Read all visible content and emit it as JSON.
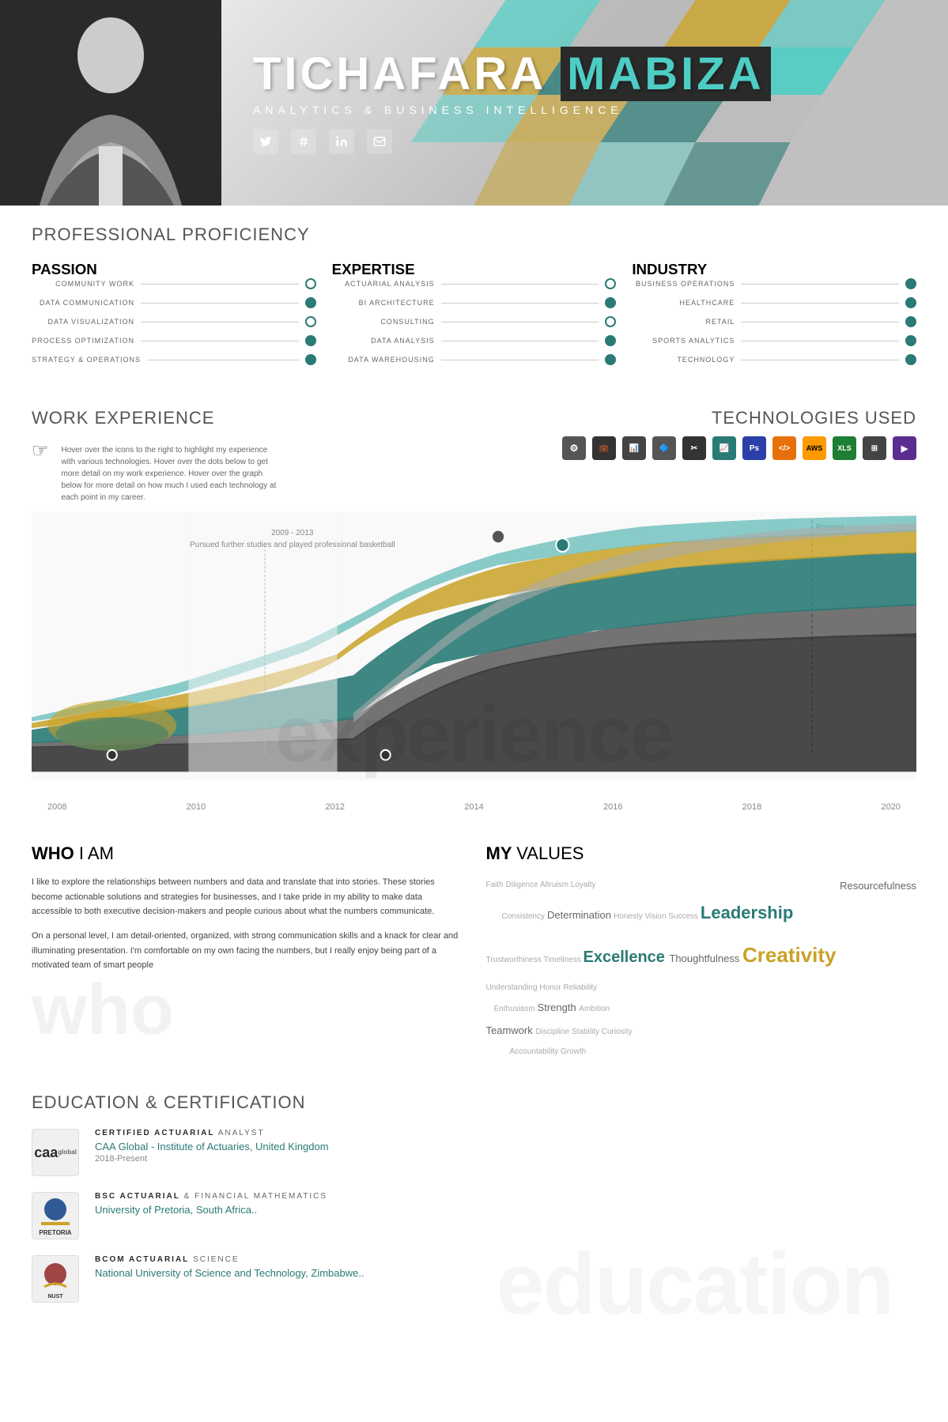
{
  "header": {
    "first_name": "TICHAFARA",
    "last_name": "MABIZA",
    "subtitle": "ANALYTICS  &  BUSINESS  INTELLIGENCE",
    "social": [
      "twitter",
      "hashtag",
      "linkedin",
      "email"
    ]
  },
  "proficiency": {
    "section_title": "PROFESSIONAL",
    "section_subtitle": "PROFICIENCY",
    "passion": {
      "title": "PASSION",
      "items": [
        {
          "label": "COMMUNITY WORK",
          "level": 3
        },
        {
          "label": "DATA COMMUNICATION",
          "level": 4
        },
        {
          "label": "DATA VISUALIZATION",
          "level": 4
        },
        {
          "label": "PROCESS OPTIMIZATION",
          "level": 4
        },
        {
          "label": "STRATEGY & OPERATIONS",
          "level": 4
        }
      ]
    },
    "expertise": {
      "title": "EXPERTISE",
      "items": [
        {
          "label": "ACTUARIAL ANALYSIS",
          "level": 4
        },
        {
          "label": "BI ARCHITECTURE",
          "level": 4
        },
        {
          "label": "CONSULTING",
          "level": 3
        },
        {
          "label": "DATA ANALYSIS",
          "level": 4
        },
        {
          "label": "DATA WAREHOUSING",
          "level": 4
        }
      ]
    },
    "industry": {
      "title": "INDUSTRY",
      "items": [
        {
          "label": "BUSINESS OPERATIONS",
          "level": 5
        },
        {
          "label": "HEALTHCARE",
          "level": 5
        },
        {
          "label": "RETAIL",
          "level": 4
        },
        {
          "label": "SPORTS ANALYTICS",
          "level": 4
        },
        {
          "label": "TECHNOLOGY",
          "level": 4
        }
      ]
    }
  },
  "work": {
    "section_title": "WORK",
    "section_subtitle": "EXPERIENCE",
    "tech_title": "TECHNOLOGIES",
    "tech_subtitle": "USED",
    "hint": "Hover over the icons to the right to highlight my experience with various technologies. Hover over the dots below to get more detail on my work experience. Hover over the graph below for more detail on how much I used each technology at each point in my career.",
    "annotation": "2009 - 2013\nPursued further studies and played professional basketball",
    "years": [
      "2008",
      "2010",
      "2012",
      "2014",
      "2016",
      "2018",
      "2020"
    ],
    "present_label": "Present",
    "watermark": "experience"
  },
  "who": {
    "title": "WHO",
    "subtitle": "I AM",
    "para1": "I like to explore the relationships between numbers and data and translate that into stories. These stories become actionable solutions and strategies for businesses, and I take pride in my ability to make data accessible to both executive decision-makers and people curious about what the numbers communicate.",
    "para2": "On a personal level, I am detail-oriented, organized, with strong communication skills and a knack for clear and illuminating presentation. I'm comfortable on my own facing the numbers, but I really enjoy being part of a motivated team of smart people",
    "watermark": "who"
  },
  "values": {
    "title": "MY",
    "subtitle": "VALUES",
    "words": [
      {
        "text": "Faith",
        "size": "small"
      },
      {
        "text": "Diligence",
        "size": "small"
      },
      {
        "text": "Altruism",
        "size": "small"
      },
      {
        "text": "Loyalty",
        "size": "small"
      },
      {
        "text": "Resourcefulness",
        "size": "medium"
      },
      {
        "text": "Consistency",
        "size": "small"
      },
      {
        "text": "Determination",
        "size": "medium"
      },
      {
        "text": "Honesty",
        "size": "small"
      },
      {
        "text": "Vision",
        "size": "small"
      },
      {
        "text": "Success",
        "size": "small"
      },
      {
        "text": "Leadership",
        "size": "large-teal"
      },
      {
        "text": "Trustworthiness",
        "size": "small"
      },
      {
        "text": "Timeliness",
        "size": "small"
      },
      {
        "text": "Excellence",
        "size": "xlarge"
      },
      {
        "text": "Thoughtfulness",
        "size": "medium"
      },
      {
        "text": "Creativity",
        "size": "xlarge-gold"
      },
      {
        "text": "Understanding",
        "size": "small"
      },
      {
        "text": "Honor",
        "size": "small"
      },
      {
        "text": "Reliability",
        "size": "small"
      },
      {
        "text": "Enthusiasm",
        "size": "small"
      },
      {
        "text": "Strength",
        "size": "small"
      },
      {
        "text": "Ambition",
        "size": "small"
      },
      {
        "text": "Teamwork",
        "size": "medium"
      },
      {
        "text": "Discipline",
        "size": "small"
      },
      {
        "text": "Stability",
        "size": "small"
      },
      {
        "text": "Curiosity",
        "size": "small"
      },
      {
        "text": "Growth",
        "size": "small"
      },
      {
        "text": "Accountability",
        "size": "small"
      }
    ]
  },
  "education": {
    "title": "EDUCATION",
    "subtitle": "& CERTIFICATION",
    "watermark": "education",
    "items": [
      {
        "logo": "caa\nglobal",
        "degree_bold": "CERTIFIED ACTUARIAL",
        "degree_rest": " ANALYST",
        "institution": "CAA Global - Institute of Actuaries, United Kingdom",
        "year": "2018-Present"
      },
      {
        "logo": "UP",
        "degree_bold": "BSC ACTUARIAL",
        "degree_rest": " & FINANCIAL MATHEMATICS",
        "institution": "University of Pretoria, South Africa..",
        "year": ""
      },
      {
        "logo": "NUST",
        "degree_bold": "BCOM ACTUARIAL",
        "degree_rest": " SCIENCE",
        "institution": "National University of Science and Technology, Zimbabwe..",
        "year": ""
      }
    ]
  }
}
